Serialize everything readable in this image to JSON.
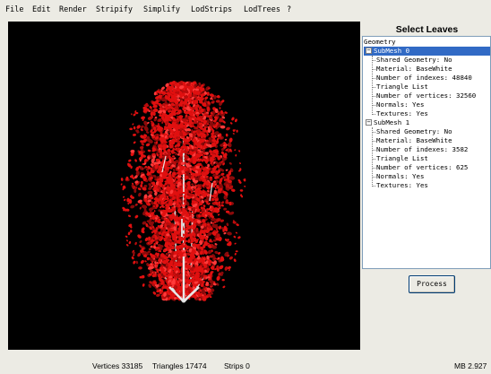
{
  "menu": [
    "File",
    "Edit",
    "Render",
    "Stripify",
    "Simplify",
    "LodStrips",
    "LodTrees",
    "?"
  ],
  "panel": {
    "title": "Select Leaves",
    "button_label": "Process"
  },
  "tree": {
    "root": "Geometry",
    "submeshes": [
      {
        "label": "SubMesh 0",
        "selected": true,
        "props": [
          "Shared Geometry: No",
          "Material: BaseWhite",
          "Number of indexes: 48840",
          "Triangle List",
          "Number of vertices: 32560",
          "Normals: Yes",
          "Textures: Yes"
        ]
      },
      {
        "label": "SubMesh 1",
        "selected": false,
        "props": [
          "Shared Geometry: No",
          "Material: BaseWhite",
          "Number of indexes: 3582",
          "Triangle List",
          "Number of vertices: 625",
          "Normals: Yes",
          "Textures: Yes"
        ]
      }
    ]
  },
  "status": {
    "vertices": "Vertices 33185",
    "triangles": "Triangles 17474",
    "strips": "Strips 0",
    "memory": "MB 2.927"
  },
  "colors": {
    "leaves": "#e01010",
    "leaves_dark": "#8a0a0a",
    "trunk": "#dcdcdc",
    "selection": "#316ac5"
  }
}
